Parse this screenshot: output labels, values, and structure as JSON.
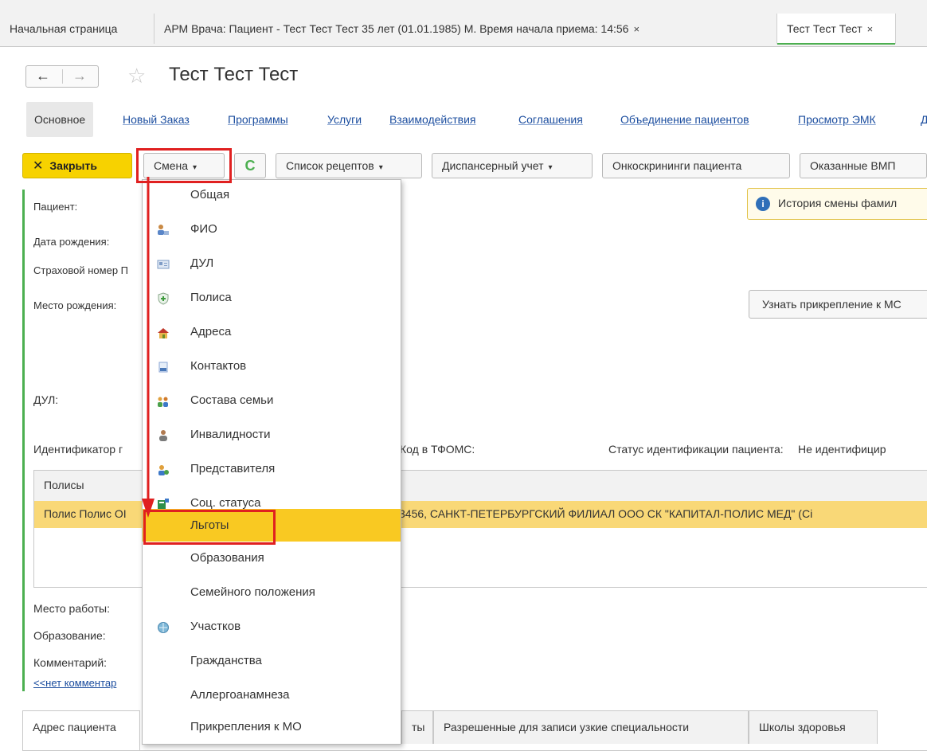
{
  "top_tabs": [
    {
      "label": "Начальная страница"
    },
    {
      "label": "АРМ Врача: Пациент - Тест Тест Тест 35 лет  (01.01.1985) М. Время начала приема: 14:56",
      "close": "×"
    },
    {
      "label": "Тест Тест Тест",
      "close": "×"
    }
  ],
  "nav": {
    "back": "←",
    "forward": "→",
    "star": "☆"
  },
  "page_title": "Тест Тест Тест",
  "sections": [
    "Основное",
    "Новый Заказ",
    "Программы",
    "Услуги",
    "Взаимодействия",
    "Соглашения",
    "Объединение пациентов",
    "Просмотр ЭМК",
    "Д"
  ],
  "toolbar": {
    "close_label": "Закрыть",
    "close_mark": "✕",
    "change_label": "Смена",
    "refresh_glyph": "C",
    "recipes_label": "Список рецептов",
    "dispensary_label": "Диспансерный учет",
    "oncoscreening_label": "Онкоскрининги пациента",
    "vmp_label": "Оказанные ВМП",
    "caret": "▾"
  },
  "form": {
    "patient_label": "Пациент:",
    "birthdate_label": "Дата рождения:",
    "insurance_label": "Страховой номер П",
    "birthplace_label": "Место рождения:",
    "dul_label": "ДУЛ:",
    "identifier_label": "Идентификатор г",
    "tfoms_label": "Код в ТФОМС:",
    "id_status_label": "Статус идентификации пациента:",
    "id_status_value": "Не идентифицир",
    "history_button": "История смены фамил",
    "info_glyph": "i",
    "attach_button": "Узнать прикрепление к МС",
    "workplace_label": "Место работы:",
    "education_label": "Образование:",
    "comment_label": "Комментарий:",
    "no_comment_link": "<<нет комментар"
  },
  "grid": {
    "header": "Полисы",
    "row_left": "Полис Полис ОІ",
    "row_right": "3456, САНКТ-ПЕТЕРБУРГСКИЙ ФИЛИАЛ ООО СК \"КАПИТАЛ-ПОЛИС МЕД\" (Сі"
  },
  "bottom_tabs": [
    "Адрес пациента",
    "ты",
    "Разрешенные для записи узкие специальности",
    "Школы здоровья"
  ],
  "menu": {
    "items": [
      {
        "label": "Общая",
        "icon": ""
      },
      {
        "label": "ФИО",
        "icon": "person-card-icon"
      },
      {
        "label": "ДУЛ",
        "icon": "id-card-icon"
      },
      {
        "label": "Полиса",
        "icon": "shield-plus-icon"
      },
      {
        "label": "Адреса",
        "icon": "house-icon"
      },
      {
        "label": "Контактов",
        "icon": "phone-icon"
      },
      {
        "label": "Состава семьи",
        "icon": "family-icon"
      },
      {
        "label": "Инвалидности",
        "icon": "person-icon"
      },
      {
        "label": "Представителя",
        "icon": "representative-icon"
      },
      {
        "label": "Соц. статуса",
        "icon": "social-status-icon"
      },
      {
        "label": "Льготы",
        "icon": "",
        "highlighted": true
      },
      {
        "label": "Образования",
        "icon": ""
      },
      {
        "label": "Семейного положения",
        "icon": ""
      },
      {
        "label": "Участков",
        "icon": "globe-icon"
      },
      {
        "label": "Гражданства",
        "icon": ""
      },
      {
        "label": "Аллергоанамнеза",
        "icon": ""
      },
      {
        "label": "Прикрепления к МО",
        "icon": ""
      }
    ]
  },
  "colors": {
    "accent_green": "#4caf50",
    "close_yellow": "#f7d200",
    "highlight": "#f9c922",
    "link_blue": "#1a4c9e",
    "annotation_red": "#e02020"
  }
}
